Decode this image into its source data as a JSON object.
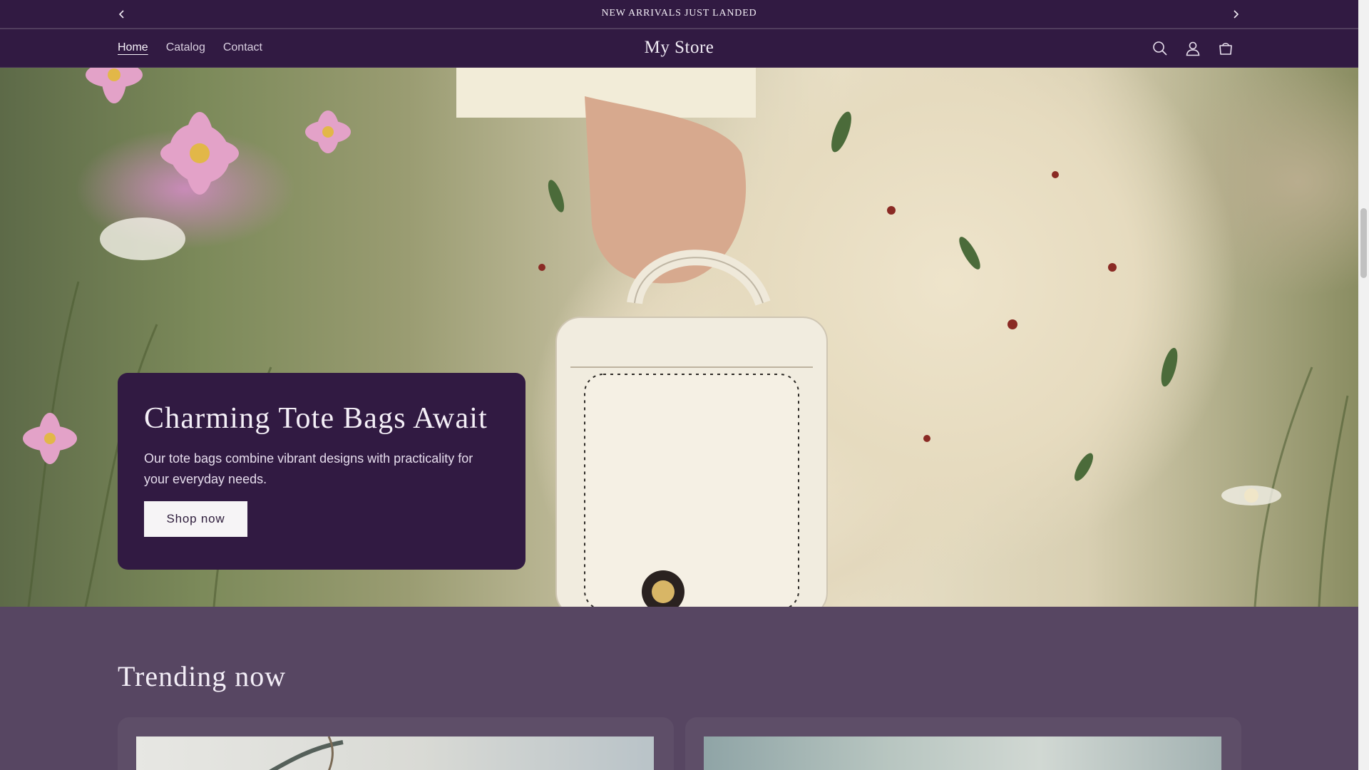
{
  "announcement": {
    "text": "NEW ARRIVALS JUST LANDED",
    "prev_icon": "chevron-left-icon",
    "next_icon": "chevron-right-icon"
  },
  "header": {
    "nav": [
      {
        "label": "Home",
        "active": true
      },
      {
        "label": "Catalog",
        "active": false
      },
      {
        "label": "Contact",
        "active": false
      }
    ],
    "store_name": "My Store",
    "icons": [
      "search-icon",
      "account-icon",
      "cart-icon"
    ]
  },
  "hero": {
    "heading": "Charming Tote Bags Await",
    "text": "Our tote bags combine vibrant designs with practicality for your everyday needs.",
    "button_label": "Shop now"
  },
  "trending": {
    "title": "Trending now"
  },
  "colors": {
    "header_bg": "#311a42",
    "page_bg": "#574662",
    "card_bg": "#5e4e68",
    "button_bg": "#f6f4f6"
  }
}
